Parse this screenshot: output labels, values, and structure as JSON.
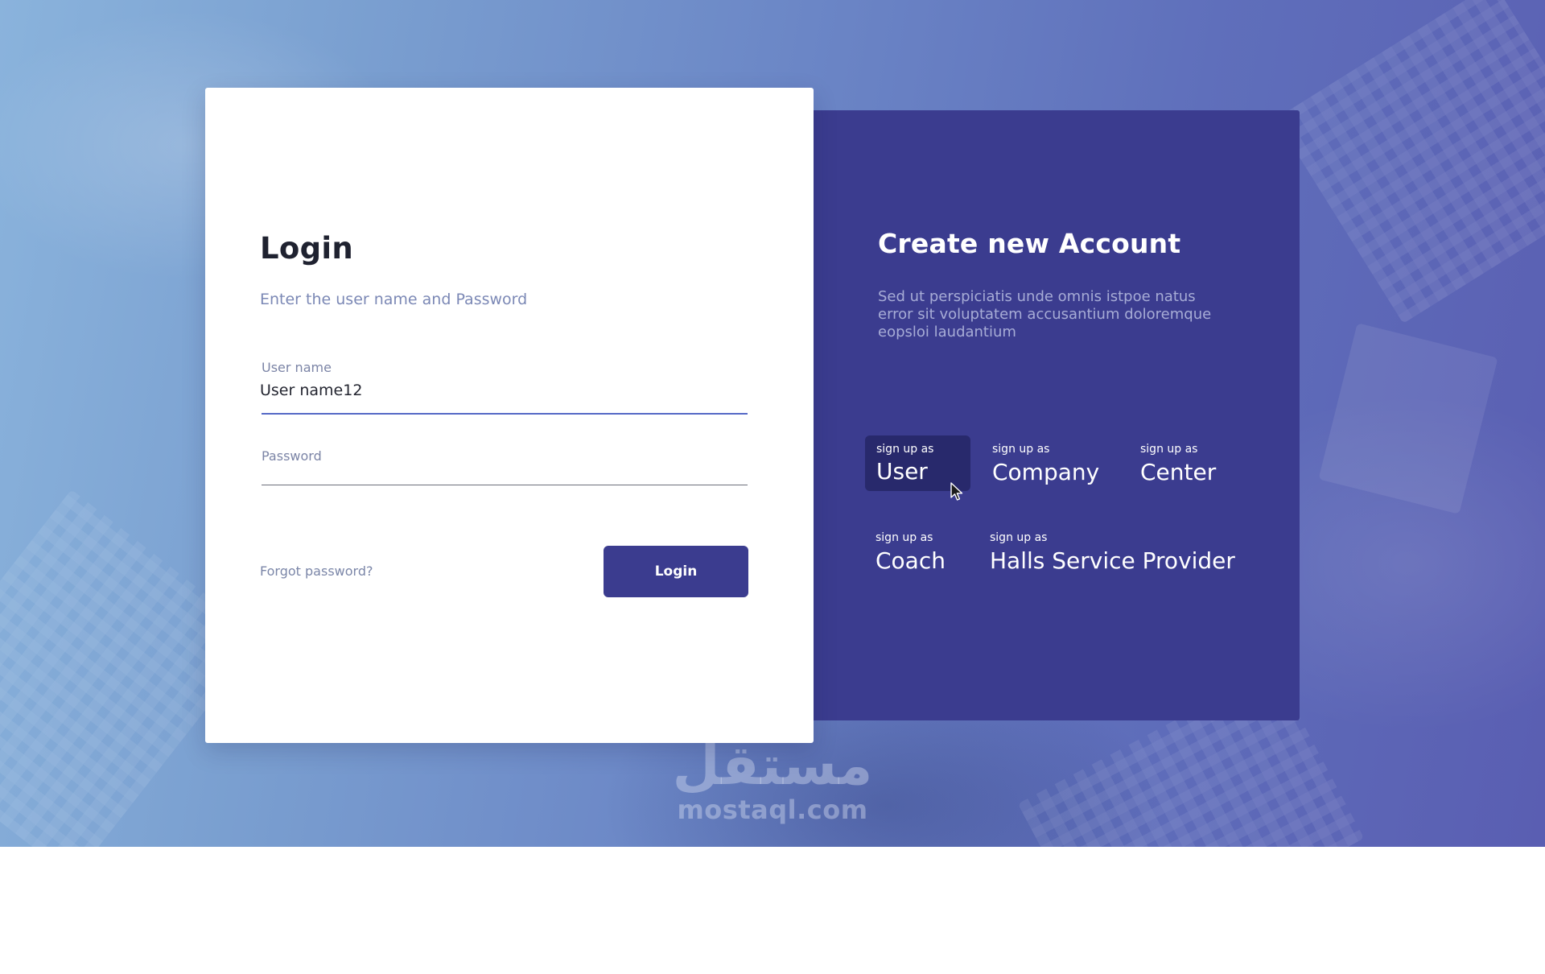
{
  "colors": {
    "accent": "#3b3c8f",
    "accent_active": "#28296c",
    "input_focus": "#5569c6",
    "muted_text": "#7b88b5",
    "heading_text": "#1f2230"
  },
  "login": {
    "title": "Login",
    "subtitle": "Enter the user name and Password",
    "username": {
      "label": "User name",
      "value": "User name12"
    },
    "password": {
      "label": "Password",
      "value": ""
    },
    "forgot_link": "Forgot password?",
    "submit_label": "Login"
  },
  "signup": {
    "title": "Create new Account",
    "description": "Sed ut perspiciatis unde omnis istpoe natus error sit voluptatem accusantium doloremque eopsloi laudantium",
    "active_role": "User",
    "roles": [
      {
        "prefix": "sign up as",
        "name": "User"
      },
      {
        "prefix": "sign up as",
        "name": "Company"
      },
      {
        "prefix": "sign up as",
        "name": "Center"
      },
      {
        "prefix": "sign up as",
        "name": "Coach"
      },
      {
        "prefix": "sign up as",
        "name": "Halls Service Provider"
      }
    ]
  },
  "watermark": {
    "arabic": "مستقل",
    "latin": "mostaql.com"
  },
  "icons": {
    "pointer": "mouse-pointer-icon"
  }
}
